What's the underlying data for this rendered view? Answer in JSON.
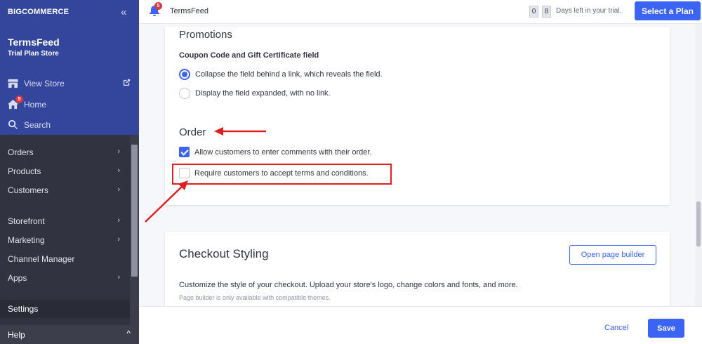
{
  "sidebar": {
    "logo": "BIGCOMMERCE",
    "collapse_glyph": "«",
    "store_name": "TermsFeed",
    "store_plan": "Trial Plan Store",
    "links": [
      {
        "label": "View Store",
        "icon": "storefront-icon"
      },
      {
        "label": "Home",
        "icon": "home-icon",
        "badge": "5"
      },
      {
        "label": "Search",
        "icon": "search-icon"
      }
    ],
    "nav": [
      {
        "label": "Orders",
        "chevron": "›"
      },
      {
        "label": "Products",
        "chevron": "›"
      },
      {
        "label": "Customers",
        "chevron": "›"
      },
      {
        "label": "Storefront",
        "chevron": "›"
      },
      {
        "label": "Marketing",
        "chevron": "›"
      },
      {
        "label": "Channel Manager",
        "chevron": ""
      },
      {
        "label": "Apps",
        "chevron": "›"
      },
      {
        "label": "Settings",
        "chevron": ""
      }
    ],
    "help": "Help",
    "help_chevron": "^"
  },
  "topbar": {
    "notification_badge": "5",
    "title": "TermsFeed",
    "trial_digits": [
      "0",
      "8"
    ],
    "trial_text": "Days left in your trial.",
    "select_plan": "Select a Plan"
  },
  "promotions": {
    "heading": "Promotions",
    "subheading": "Coupon Code and Gift Certificate field",
    "options": [
      {
        "label": "Collapse the field behind a link, which reveals the field.",
        "selected": true
      },
      {
        "label": "Display the field expanded, with no link.",
        "selected": false
      }
    ]
  },
  "order": {
    "heading": "Order",
    "checkboxes": [
      {
        "label": "Allow customers to enter comments with their order.",
        "checked": true
      },
      {
        "label": "Require customers to accept terms and conditions.",
        "checked": false
      }
    ]
  },
  "checkout_styling": {
    "heading": "Checkout Styling",
    "button": "Open page builder",
    "description": "Customize the style of your checkout. Upload your store's logo, change colors and fonts, and more.",
    "note": "Page builder is only available with compatible themes."
  },
  "footer": {
    "cancel": "Cancel",
    "save": "Save"
  },
  "colors": {
    "accent": "#3c64f4",
    "sidebar_top": "#34469c",
    "sidebar": "#313440",
    "annotation": "#e02020"
  }
}
